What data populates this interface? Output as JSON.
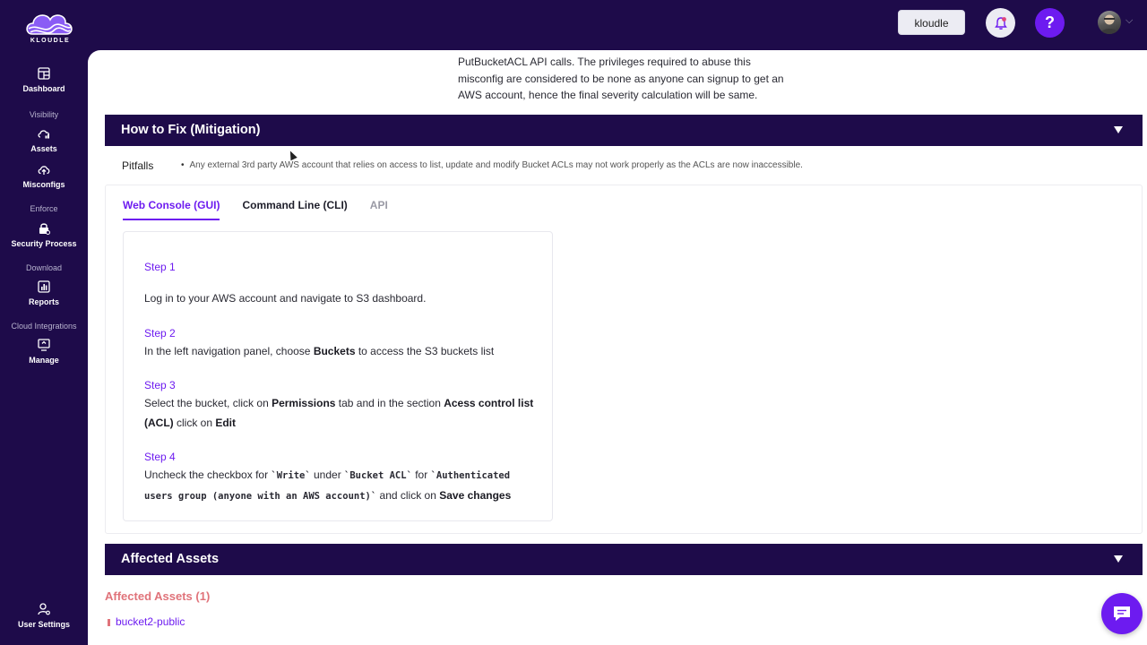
{
  "app": {
    "logo_text": "KLOUDLE",
    "org_button": "kloudle",
    "help_label": "?"
  },
  "sidebar": {
    "items": [
      {
        "group": "",
        "label": "Dashboard",
        "icon": "dashboard-icon"
      },
      {
        "group": "Visibility",
        "label": "Assets",
        "icon": "cloud-assets-icon"
      },
      {
        "group": "",
        "label": "Misconfigs",
        "icon": "cloud-upload-icon"
      },
      {
        "group": "Enforce",
        "label": "Security Process",
        "icon": "lock-icon"
      },
      {
        "group": "Download",
        "label": "Reports",
        "icon": "report-chart-icon"
      },
      {
        "group": "Cloud Integrations",
        "label": "Manage",
        "icon": "manage-icon"
      }
    ],
    "user_settings": "User Settings",
    "collapse_label": "«"
  },
  "intro": {
    "text": "PutBucketACL API calls. The privileges required to abuse this misconfig are considered to be none as anyone can signup to get an AWS account, hence the final severity calculation will be same."
  },
  "mitigation": {
    "title": "How to Fix (Mitigation)",
    "pitfalls_label": "Pitfalls",
    "pitfalls_text": "Any external 3rd party AWS account that relies on access to list, update and modify Bucket ACLs may not work properly as the ACLs are now inaccessible.",
    "tabs": [
      {
        "label": "Web Console (GUI)",
        "state": "active"
      },
      {
        "label": "Command Line (CLI)",
        "state": "normal"
      },
      {
        "label": "API",
        "state": "disabled"
      }
    ],
    "steps": [
      {
        "head": "Step 1",
        "body": "Log in to your AWS account and navigate to S3 dashboard."
      },
      {
        "head": "Step 2",
        "pre": "In the left navigation panel, choose ",
        "b1": "Buckets",
        "post": " to access the S3 buckets list"
      },
      {
        "head": "Step 3",
        "pre": "Select the bucket, click on ",
        "b1": "Permissions",
        "mid": " tab and in the section ",
        "b2": "Acess control list (ACL)",
        "mid2": " click on ",
        "b3": "Edit"
      },
      {
        "head": "Step 4",
        "pre": "Uncheck the checkbox for ",
        "c1": "`Write`",
        "mid": " under ",
        "c2": "`Bucket ACL`",
        "mid2": " for ",
        "c3": "`Authenticated users group (anyone with an AWS account)`",
        "mid3": " and click on ",
        "b1": "Save changes"
      }
    ]
  },
  "affected": {
    "section_title": "Affected Assets",
    "count_title": "Affected Assets (1)",
    "assets": [
      "bucket2-public"
    ]
  },
  "colors": {
    "brand_dark": "#1e0b4a",
    "accent": "#6d1bf0",
    "danger": "#e0737a"
  }
}
